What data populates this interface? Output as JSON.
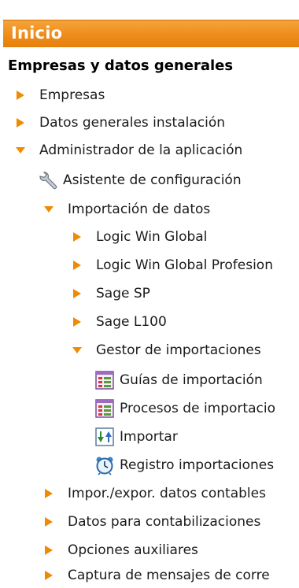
{
  "header": {
    "title": "Inicio"
  },
  "section": {
    "title": "Empresas y datos generales"
  },
  "colors": {
    "accent": "#ee8c1a",
    "arrow": "#f08a00"
  },
  "tree": [
    {
      "label": "Empresas",
      "expander": "collapsed-arrow-icon"
    },
    {
      "label": "Datos generales instalación",
      "expander": "collapsed-arrow-icon"
    },
    {
      "label": "Administrador de la aplicación",
      "expander": "expanded-arrow-icon"
    },
    {
      "label": "Asistente de configuración",
      "icon": "wrench-icon"
    },
    {
      "label": "Importación de datos",
      "expander": "expanded-arrow-icon"
    },
    {
      "label": "Logic Win Global",
      "expander": "collapsed-arrow-icon"
    },
    {
      "label": "Logic Win Global Profesion",
      "expander": "collapsed-arrow-icon"
    },
    {
      "label": "Sage SP",
      "expander": "collapsed-arrow-icon"
    },
    {
      "label": "Sage L100",
      "expander": "collapsed-arrow-icon"
    },
    {
      "label": "Gestor de importaciones",
      "expander": "expanded-arrow-icon"
    },
    {
      "label": "Guías de importación",
      "icon": "grid-form-icon"
    },
    {
      "label": "Procesos de importacio",
      "icon": "grid-form-icon"
    },
    {
      "label": "Importar",
      "icon": "import-arrows-icon"
    },
    {
      "label": "Registro importaciones",
      "icon": "alarm-clock-icon"
    },
    {
      "label": "Impor./expor. datos contables",
      "expander": "collapsed-arrow-icon"
    },
    {
      "label": "Datos para contabilizaciones",
      "expander": "collapsed-arrow-icon"
    },
    {
      "label": "Opciones auxiliares",
      "expander": "collapsed-arrow-icon"
    },
    {
      "label": "Captura de mensajes de corre",
      "expander": "collapsed-arrow-icon"
    }
  ]
}
